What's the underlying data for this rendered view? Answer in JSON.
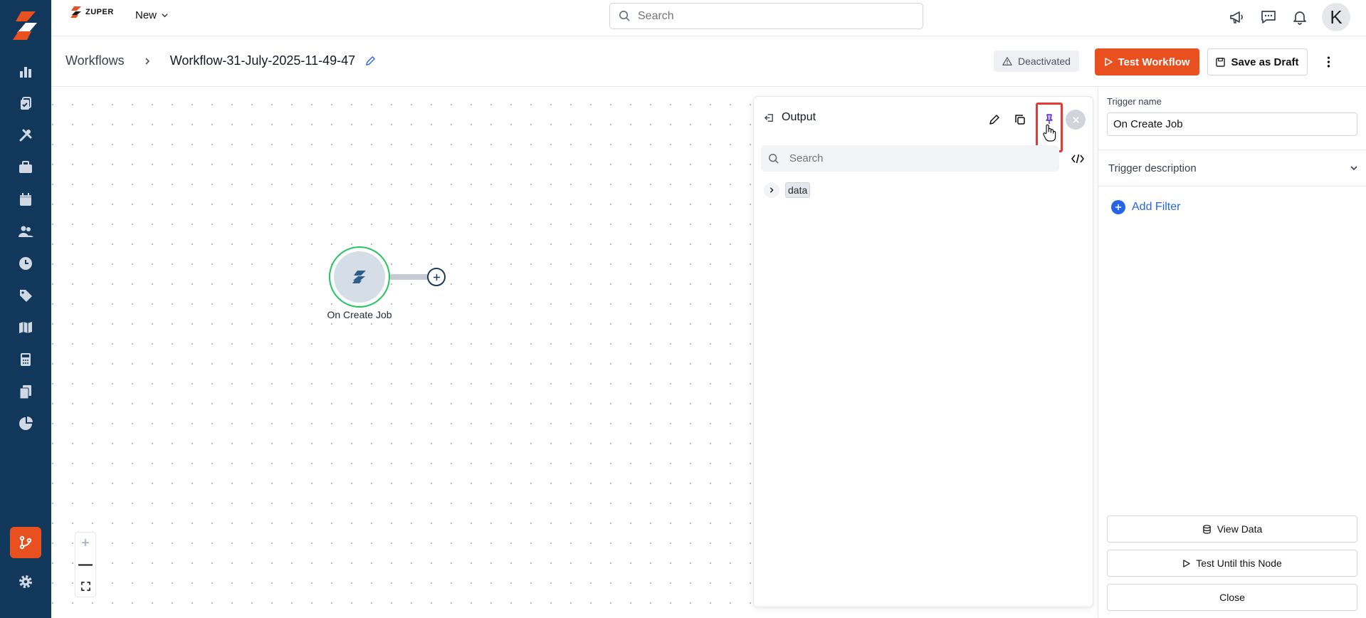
{
  "app": {
    "brand": "ZUPER",
    "new_menu_label": "New"
  },
  "topbar": {
    "search_placeholder": "Search",
    "avatar_initial": "K",
    "icons": [
      "megaphone-icon",
      "chat-icon",
      "bell-icon"
    ]
  },
  "sidebar": {
    "items": [
      {
        "icon": "bar-chart-icon"
      },
      {
        "icon": "jobs-icon"
      },
      {
        "icon": "tools-icon"
      },
      {
        "icon": "briefcase-icon"
      },
      {
        "icon": "calendar-icon"
      },
      {
        "icon": "users-icon"
      },
      {
        "icon": "clock-icon"
      },
      {
        "icon": "tag-icon"
      },
      {
        "icon": "map-icon"
      },
      {
        "icon": "calculator-icon"
      },
      {
        "icon": "documents-icon"
      },
      {
        "icon": "pie-chart-icon"
      },
      {
        "icon": "workflow-icon",
        "active": true
      },
      {
        "icon": "settings-icon"
      }
    ],
    "active_color": "#e8501f",
    "background": "#11375a"
  },
  "header": {
    "breadcrumb_root": "Workflows",
    "breadcrumb_current": "Workflow-31-July-2025-11-49-47",
    "status": "Deactivated",
    "test_button": "Test Workflow",
    "draft_button": "Save as Draft"
  },
  "canvas": {
    "node_label": "On Create Job",
    "zoom_in": "+",
    "zoom_out": "—"
  },
  "output": {
    "title": "Output",
    "search_placeholder": "Search",
    "tree_key": "data"
  },
  "trigger": {
    "name_label": "Trigger name",
    "name_value": "On Create Job",
    "description_label": "Trigger description",
    "add_filter": "Add Filter",
    "view_data": "View Data",
    "test_until": "Test Until this Node",
    "close": "Close"
  }
}
